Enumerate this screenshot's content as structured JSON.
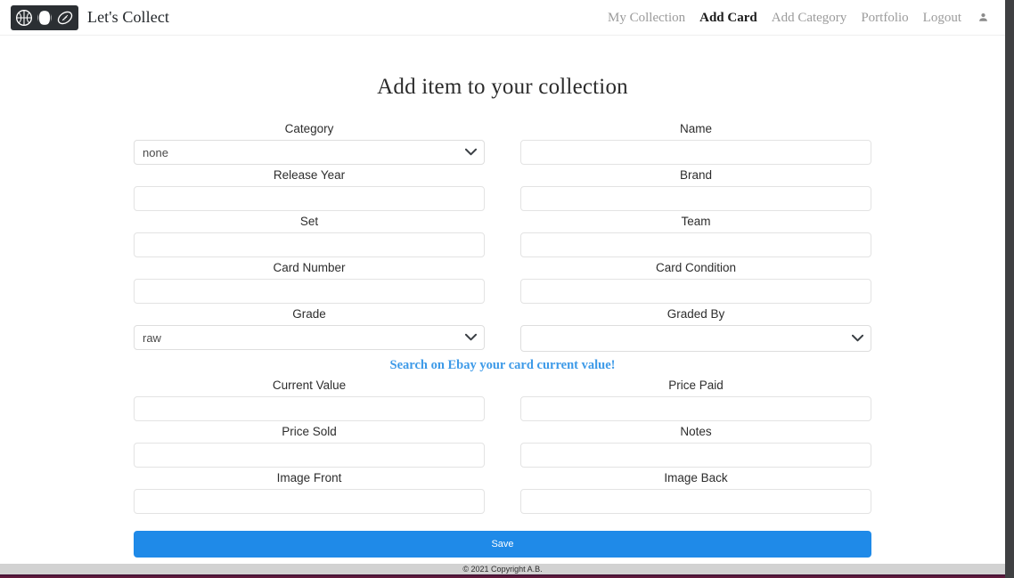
{
  "brand": {
    "name": "Let's Collect",
    "logo_icons": [
      "basketball-icon",
      "baseball-icon",
      "football-icon"
    ],
    "logo_bg": "#2b2f33"
  },
  "nav": {
    "items": [
      {
        "label": "My Collection",
        "active": false
      },
      {
        "label": "Add Card",
        "active": true
      },
      {
        "label": "Add Category",
        "active": false
      },
      {
        "label": "Portfolio",
        "active": false
      },
      {
        "label": "Logout",
        "active": false
      }
    ],
    "user_icon": "person-icon",
    "inactive_color": "#9b9b9b",
    "active_color": "#1b1b1b"
  },
  "main": {
    "title": "Add item to your collection",
    "fields": {
      "category": {
        "label": "Category",
        "value": "none",
        "type": "select"
      },
      "name": {
        "label": "Name",
        "value": "",
        "type": "text"
      },
      "release_year": {
        "label": "Release Year",
        "value": "",
        "type": "text"
      },
      "brand": {
        "label": "Brand",
        "value": "",
        "type": "text"
      },
      "set": {
        "label": "Set",
        "value": "",
        "type": "text"
      },
      "team": {
        "label": "Team",
        "value": "",
        "type": "text"
      },
      "card_number": {
        "label": "Card Number",
        "value": "",
        "type": "text"
      },
      "card_condition": {
        "label": "Card Condition",
        "value": "",
        "type": "text"
      },
      "grade": {
        "label": "Grade",
        "value": "raw",
        "type": "select"
      },
      "graded_by": {
        "label": "Graded By",
        "value": "",
        "type": "select"
      },
      "current_value": {
        "label": "Current Value",
        "value": "",
        "type": "text"
      },
      "price_paid": {
        "label": "Price Paid",
        "value": "",
        "type": "text"
      },
      "price_sold": {
        "label": "Price Sold",
        "value": "",
        "type": "text"
      },
      "notes": {
        "label": "Notes",
        "value": "",
        "type": "text"
      },
      "image_front": {
        "label": "Image Front",
        "value": "",
        "type": "text"
      },
      "image_back": {
        "label": "Image Back",
        "value": "",
        "type": "text"
      }
    },
    "ebay_link": {
      "label": "Search on Ebay your card current value!",
      "color": "#3d9ae8"
    },
    "save_button": {
      "label": "Save",
      "color": "#1f8ae8"
    }
  },
  "footer": {
    "text": "© 2021 Copyright A.B.",
    "bar_color": "#d2d2d2",
    "band_color": "#4a1538"
  }
}
